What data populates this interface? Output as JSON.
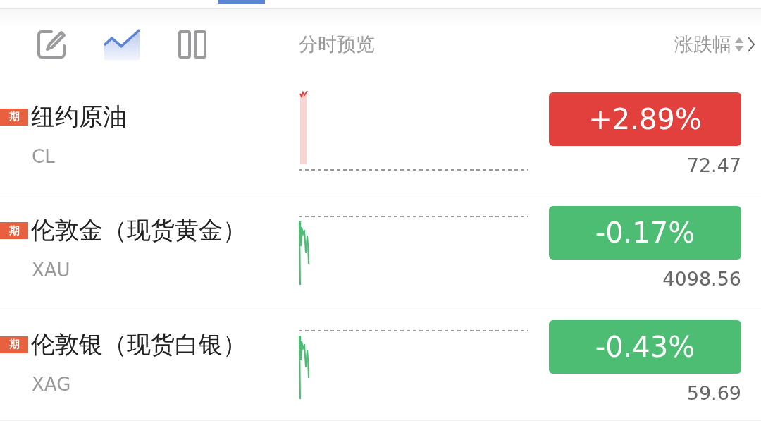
{
  "toolbar": {
    "views": [
      {
        "kind": "edit",
        "selected": false
      },
      {
        "kind": "chart",
        "selected": true
      },
      {
        "kind": "columns",
        "selected": false
      }
    ],
    "preview_label": "分时预览",
    "sort_label": "涨跌幅"
  },
  "rows": [
    {
      "badge": "期",
      "name": "纽约原油",
      "code": "CL",
      "kind": "up",
      "change": "+2.89%",
      "price": "72.47"
    },
    {
      "badge": "期",
      "name": "伦敦金（现货黄金）",
      "code": "XAU",
      "kind": "down",
      "change": "-0.17%",
      "price": "4098.56"
    },
    {
      "badge": "期",
      "name": "伦敦银（现货白银）",
      "code": "XAG",
      "kind": "down",
      "change": "-0.43%",
      "price": "59.69"
    }
  ]
}
